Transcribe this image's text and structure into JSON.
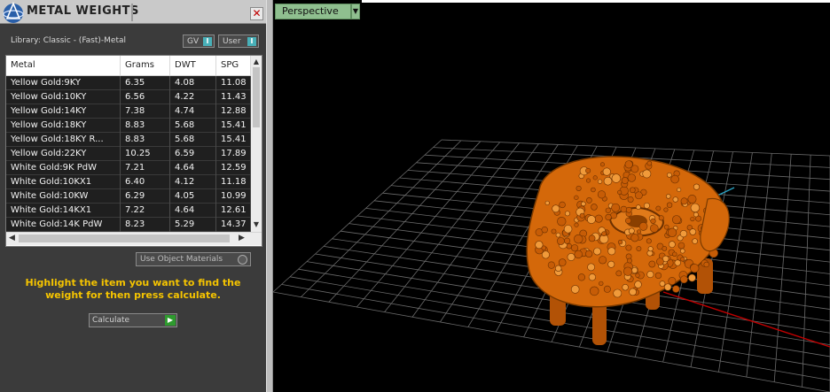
{
  "panel": {
    "title": "METAL WEIGHTS",
    "close_label": "✕",
    "library_label": "Library: Classic - (Fast)-Metal",
    "toggles": [
      {
        "label": "GV",
        "indicator": "I"
      },
      {
        "label": "User",
        "indicator": "I"
      }
    ],
    "table": {
      "headers": [
        "Metal",
        "Grams",
        "DWT",
        "SPG"
      ],
      "rows": [
        [
          "Yellow Gold:9KY",
          "6.35",
          "4.08",
          "11.08"
        ],
        [
          "Yellow Gold:10KY",
          "6.56",
          "4.22",
          "11.43"
        ],
        [
          "Yellow Gold:14KY",
          "7.38",
          "4.74",
          "12.88"
        ],
        [
          "Yellow Gold:18KY",
          "8.83",
          "5.68",
          "15.41"
        ],
        [
          "Yellow Gold:18KY R...",
          "8.83",
          "5.68",
          "15.41"
        ],
        [
          "Yellow Gold:22KY",
          "10.25",
          "6.59",
          "17.89"
        ],
        [
          "White Gold:9K PdW",
          "7.21",
          "4.64",
          "12.59"
        ],
        [
          "White Gold:10KX1",
          "6.40",
          "4.12",
          "11.18"
        ],
        [
          "White Gold:10KW",
          "6.29",
          "4.05",
          "10.99"
        ],
        [
          "White Gold:14KX1",
          "7.22",
          "4.64",
          "12.61"
        ],
        [
          "White Gold:14K PdW",
          "8.23",
          "5.29",
          "14.37"
        ]
      ]
    },
    "use_object_materials_label": "Use Object Materials",
    "instructions": "Highlight the item you want to find the weight for then press calculate.",
    "calculate_label": "Calculate",
    "accent_color": "#f5c400"
  },
  "viewport": {
    "view_label": "Perspective",
    "dropdown_icon": "caret-down-icon",
    "model_color": "#d4680a",
    "grid_color": "#6a6a6a",
    "x_axis_color": "#c00000",
    "y_axis_color": "#2aa0c0"
  },
  "icons": {
    "logo": "app-logo-icon",
    "close": "close-icon"
  }
}
